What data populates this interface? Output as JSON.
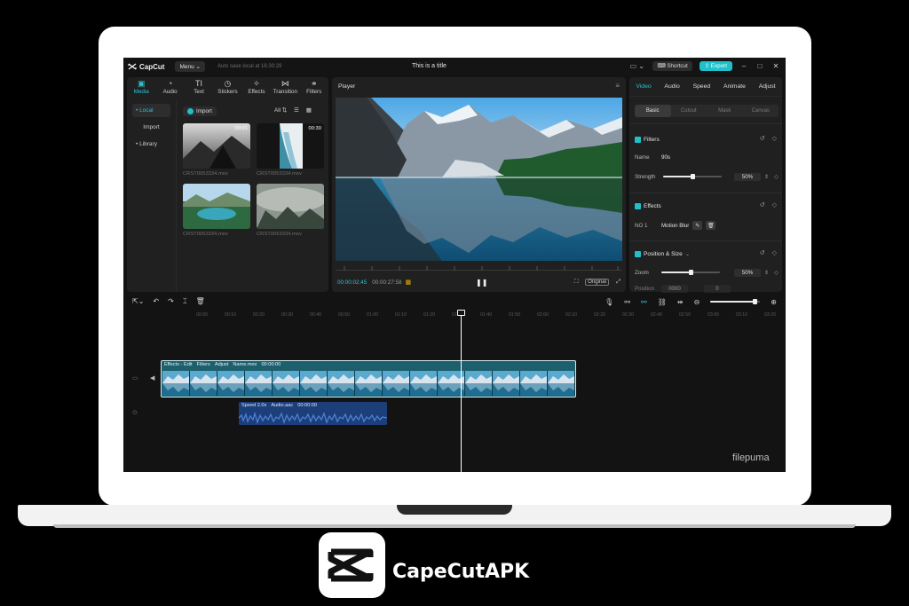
{
  "app": {
    "name": "CapCut",
    "menu_label": "Menu",
    "autosave": "Auto save local at 16:30:29",
    "doc_title": "This is a title",
    "shortcut_label": "Shortcut",
    "export_label": "Export",
    "accent_color": "#1ec0c9"
  },
  "media": {
    "tabs": [
      {
        "label": "Media",
        "icon": "media-icon"
      },
      {
        "label": "Audio",
        "icon": "audio-icon"
      },
      {
        "label": "Text",
        "icon": "text-icon"
      },
      {
        "label": "Stickers",
        "icon": "stickers-icon"
      },
      {
        "label": "Effects",
        "icon": "effects-icon"
      },
      {
        "label": "Transition",
        "icon": "transition-icon"
      },
      {
        "label": "Filters",
        "icon": "filters-icon"
      }
    ],
    "side": [
      "• Local",
      "Import",
      "• Library"
    ],
    "import_label": "Import",
    "all_label": "All",
    "items": [
      {
        "name": "CRST0053334.mov",
        "duration": "00:01"
      },
      {
        "name": "CRST0053334.mov",
        "duration": "00:30"
      },
      {
        "name": "CRST0053334.mov",
        "duration": ""
      },
      {
        "name": "CRST0053334.mov",
        "duration": ""
      }
    ]
  },
  "player": {
    "title": "Player",
    "current_time": "00:00:02:45",
    "duration": "00:00:27:58",
    "original_label": "Original"
  },
  "properties": {
    "tabs": [
      "Video",
      "Audio",
      "Speed",
      "Animate",
      "Adjust"
    ],
    "subtabs": [
      "Basic",
      "Cutout",
      "Mask",
      "Canvas"
    ],
    "filters": {
      "title": "Filters",
      "name_label": "Name",
      "name_value": "90s",
      "strength_label": "Strength",
      "strength_value": "50%",
      "strength_level": 0.5
    },
    "effects": {
      "title": "Effects",
      "no_label": "NO 1",
      "effect_name": "Motion Blur"
    },
    "position": {
      "title": "Position & Size",
      "zoom_label": "Zoom",
      "zoom_value": "50%",
      "zoom_level": 0.5,
      "position_label": "Position",
      "pos_x": "0000",
      "pos_y": "0"
    }
  },
  "timeline": {
    "ticks": [
      "00:00",
      "00:10",
      "00:20",
      "00:30",
      "00:40",
      "00:50",
      "01:00",
      "01:10",
      "01:20",
      "01:30",
      "01:40",
      "01:50",
      "02:00",
      "02:10",
      "02:20",
      "02:30",
      "02:40",
      "02:50",
      "03:00",
      "03:10",
      "03:20"
    ],
    "main_clip": {
      "effects": "Effects - Edit",
      "filters": "Filters",
      "adjust": "Adjust",
      "name": "Name.mov",
      "time": "00:00:00"
    },
    "audio_clip": {
      "speed": "Speed 2.0x",
      "name": "Audio.aac",
      "time": "00:00:00"
    }
  },
  "watermark": "filepuma",
  "brand": {
    "name": "CapeCutAPK"
  }
}
